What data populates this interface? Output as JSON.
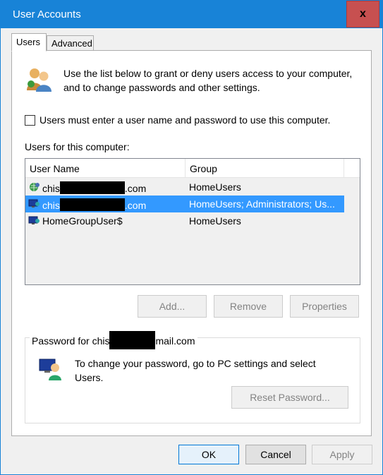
{
  "window": {
    "title": "User Accounts",
    "close_label": "x"
  },
  "tabs": [
    {
      "label": "Users",
      "active": true
    },
    {
      "label": "Advanced",
      "active": false
    }
  ],
  "intro": {
    "icon": "users-icon",
    "text": "Use the list below to grant or deny users access to your computer, and to change passwords and other settings."
  },
  "require_password": {
    "label": "Users must enter a user name and password to use this computer.",
    "checked": false
  },
  "users_list": {
    "label": "Users for this computer:",
    "columns": [
      "User Name",
      "Group"
    ],
    "rows": [
      {
        "name_prefix": "chis",
        "name_suffix": ".com",
        "redacted": true,
        "group": "HomeUsers",
        "selected": false,
        "icon": "user-globe-icon"
      },
      {
        "name_prefix": "chis",
        "name_suffix": ".com",
        "redacted": true,
        "group": "HomeUsers; Administrators; Us...",
        "selected": true,
        "icon": "user-monitor-icon"
      },
      {
        "name_prefix": "HomeGroupUser$",
        "name_suffix": "",
        "redacted": false,
        "group": "HomeUsers",
        "selected": false,
        "icon": "user-monitor-icon"
      }
    ]
  },
  "list_buttons": {
    "add": "Add...",
    "remove": "Remove",
    "properties": "Properties"
  },
  "password_group": {
    "label_prefix": "Password for chis",
    "label_suffix": "mail.com",
    "text": "To change your password, go to PC settings and select Users.",
    "reset_button": "Reset Password..."
  },
  "footer": {
    "ok": "OK",
    "cancel": "Cancel",
    "apply": "Apply"
  },
  "colors": {
    "titlebar": "#1883d7",
    "close": "#c75050",
    "selection": "#3399ff"
  }
}
